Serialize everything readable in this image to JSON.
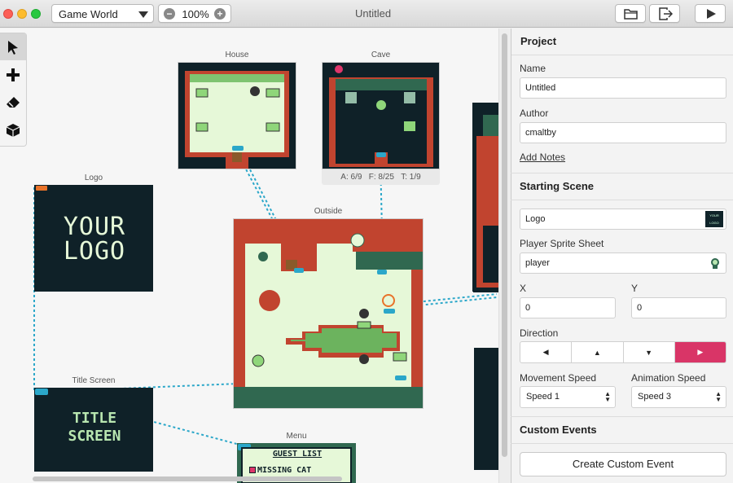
{
  "window": {
    "title": "Untitled"
  },
  "toolbar": {
    "world_select": "Game World",
    "zoom": "100%",
    "open_icon": "folder-open-icon",
    "export_icon": "export-icon",
    "play_icon": "play-icon"
  },
  "tools": [
    "select-cursor-icon",
    "add-plus-icon",
    "eraser-icon",
    "cube-icon"
  ],
  "scenes": {
    "house": {
      "label": "House"
    },
    "cave": {
      "label": "Cave",
      "stats_a": "A: 6/9",
      "stats_f": "F: 8/25",
      "stats_t": "T: 1/9"
    },
    "logo": {
      "label": "Logo",
      "text_line1": "YOUR",
      "text_line2": "LOGO"
    },
    "outside": {
      "label": "Outside"
    },
    "title_screen": {
      "label": "Title Screen",
      "text_line1": "TITLE",
      "text_line2": "SCREEN"
    },
    "menu": {
      "label": "Menu",
      "line1": "GUEST LIST",
      "line2": "MISSING CAT"
    }
  },
  "sidebar": {
    "project_heading": "Project",
    "name_label": "Name",
    "name_value": "Untitled",
    "author_label": "Author",
    "author_value": "cmaltby",
    "add_notes": "Add Notes",
    "starting_scene_heading": "Starting Scene",
    "starting_scene_value": "Logo",
    "starting_scene_thumb": "YOUR LOGO",
    "sprite_label": "Player Sprite Sheet",
    "sprite_value": "player",
    "x_label": "X",
    "x_value": "0",
    "y_label": "Y",
    "y_value": "0",
    "direction_label": "Direction",
    "directions": [
      "◀",
      "▲",
      "▼",
      "▶"
    ],
    "direction_selected": "right",
    "move_speed_label": "Movement Speed",
    "move_speed_value": "Speed 1",
    "anim_speed_label": "Animation Speed",
    "anim_speed_value": "Speed 3",
    "custom_events_heading": "Custom Events",
    "create_event_button": "Create Custom Event"
  },
  "colors": {
    "accent": "#d93567",
    "link_line": "#2ba7c9",
    "scene_dark": "#0f2128",
    "gb_light": "#e6f8d8",
    "gb_red": "#c1442f",
    "gb_green": "#306850"
  }
}
